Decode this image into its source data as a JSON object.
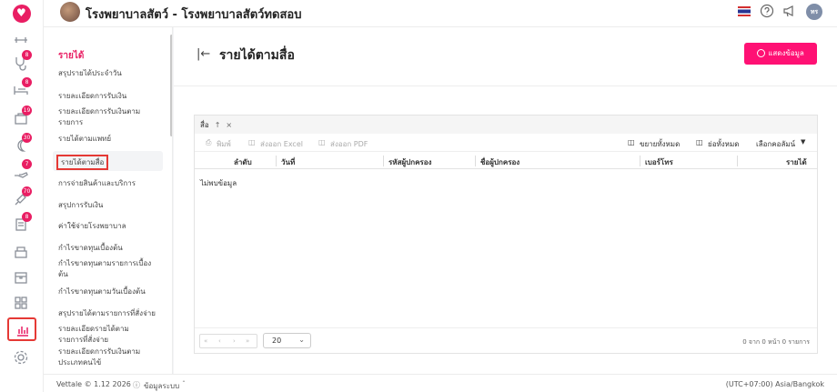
{
  "app": {
    "title": "โรงพยาบาลสัตว์ - โรงพยาบาลสัตว์ทดสอบ",
    "user_initials": "ทร"
  },
  "rail": {
    "badges": [
      "8",
      "8",
      "19",
      "30",
      "7",
      "70",
      "8"
    ]
  },
  "sidebar": {
    "heading": "รายได้",
    "items": [
      "สรุปรายได้ประจำวัน",
      "รายละเอียดการรับเงิน",
      "รายละเอียดการรับเงินตามรายการ",
      "รายได้ตามแพทย์",
      "รายได้ตามสื่อ",
      "การจ่ายสินค้าและบริการ",
      "สรุปการรับเงิน",
      "ค่าใช้จ่ายโรงพยาบาล",
      "กำไรขาดทุนเบื้องต้น",
      "กำไรขาดทุนตามรายการเบื้องต้น",
      "กำไรขาดทุนตามวันเบื้องต้น",
      "สรุปรายได้ตามรายการที่สั่งจ่าย",
      "รายละเอียดรายได้ตามรายการที่สั่งจ่าย",
      "รายละเอียดการรับเงินตามประเภทคนไข้"
    ]
  },
  "page": {
    "title": "รายได้ตามสื่อ",
    "show_button": "แสดงข้อมูล"
  },
  "grid": {
    "group_chip": "สื่อ",
    "toolbar": {
      "print": "พิมพ์",
      "export_excel": "ส่งออก Excel",
      "export_pdf": "ส่งออก PDF",
      "expand_all": "ขยายทั้งหมด",
      "collapse_all": "ย่อทั้งหมด",
      "choose_columns": "เลือกคอลัมน์"
    },
    "columns": [
      "ลำดับ",
      "วันที่",
      "รหัสผู้ปกครอง",
      "ชื่อผู้ปกครอง",
      "เบอร์โทร",
      "รายได้"
    ],
    "empty": "ไม่พบข้อมูล",
    "page_size": "20",
    "page_info": "0 จาก 0 หน้า 0 รายการ"
  },
  "footer": {
    "version": "Vettale © 1.12 2026",
    "system_info": "ข้อมูลระบบ",
    "timezone": "(UTC+07:00) Asia/Bangkok"
  }
}
